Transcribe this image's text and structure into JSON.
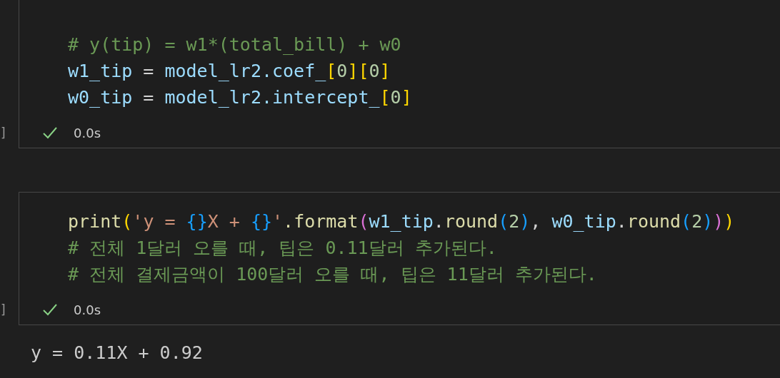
{
  "cells": [
    {
      "exec_count": "]",
      "status": "0.0s",
      "succeeded": true,
      "lines": [
        [
          {
            "kind": "comment",
            "text": "# y(tip) = w1*(total_bill) + w0"
          }
        ],
        [
          {
            "kind": "variable",
            "text": "w1_tip"
          },
          {
            "kind": "operator",
            "text": " = "
          },
          {
            "kind": "variable",
            "text": "model_lr2.coef_"
          },
          {
            "kind": "bracket1",
            "text": "["
          },
          {
            "kind": "number",
            "text": "0"
          },
          {
            "kind": "bracket1",
            "text": "]["
          },
          {
            "kind": "number",
            "text": "0"
          },
          {
            "kind": "bracket1",
            "text": "]"
          }
        ],
        [
          {
            "kind": "variable",
            "text": "w0_tip"
          },
          {
            "kind": "operator",
            "text": " = "
          },
          {
            "kind": "variable",
            "text": "model_lr2.intercept_"
          },
          {
            "kind": "bracket1",
            "text": "["
          },
          {
            "kind": "number",
            "text": "0"
          },
          {
            "kind": "bracket1",
            "text": "]"
          }
        ]
      ]
    },
    {
      "exec_count": "]",
      "status": "0.0s",
      "succeeded": true,
      "lines": [
        [
          {
            "kind": "function",
            "text": "print"
          },
          {
            "kind": "bracket1",
            "text": "("
          },
          {
            "kind": "string",
            "text": "'y = "
          },
          {
            "kind": "bracket3",
            "text": "{}"
          },
          {
            "kind": "string",
            "text": "X + "
          },
          {
            "kind": "bracket3",
            "text": "{}"
          },
          {
            "kind": "string",
            "text": "'"
          },
          {
            "kind": "function",
            "text": ".format"
          },
          {
            "kind": "bracket2",
            "text": "("
          },
          {
            "kind": "variable",
            "text": "w1_tip"
          },
          {
            "kind": "operator",
            "text": "."
          },
          {
            "kind": "function",
            "text": "round"
          },
          {
            "kind": "bracket3",
            "text": "("
          },
          {
            "kind": "number",
            "text": "2"
          },
          {
            "kind": "bracket3",
            "text": ")"
          },
          {
            "kind": "operator",
            "text": ", "
          },
          {
            "kind": "variable",
            "text": "w0_tip"
          },
          {
            "kind": "operator",
            "text": "."
          },
          {
            "kind": "function",
            "text": "round"
          },
          {
            "kind": "bracket3",
            "text": "("
          },
          {
            "kind": "number",
            "text": "2"
          },
          {
            "kind": "bracket3",
            "text": ")"
          },
          {
            "kind": "bracket2",
            "text": ")"
          },
          {
            "kind": "bracket1",
            "text": ")"
          }
        ],
        [
          {
            "kind": "comment",
            "text": "# 전체 1달러 오를 때, 팁은 0.11달러 추가된다."
          }
        ],
        [
          {
            "kind": "comment",
            "text": "# 전체 결제금액이 100달러 오를 때, 팁은 11달러 추가된다."
          }
        ]
      ],
      "output": "y = 0.11X + 0.92"
    }
  ]
}
